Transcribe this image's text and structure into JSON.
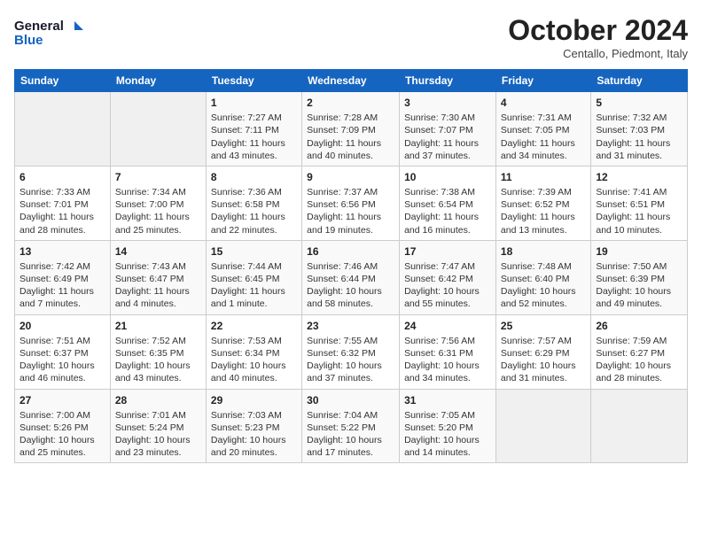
{
  "header": {
    "logo_general": "General",
    "logo_blue": "Blue",
    "month_title": "October 2024",
    "location": "Centallo, Piedmont, Italy"
  },
  "weekdays": [
    "Sunday",
    "Monday",
    "Tuesday",
    "Wednesday",
    "Thursday",
    "Friday",
    "Saturday"
  ],
  "weeks": [
    [
      {
        "day": "",
        "data": ""
      },
      {
        "day": "",
        "data": ""
      },
      {
        "day": "1",
        "data": "Sunrise: 7:27 AM\nSunset: 7:11 PM\nDaylight: 11 hours and 43 minutes."
      },
      {
        "day": "2",
        "data": "Sunrise: 7:28 AM\nSunset: 7:09 PM\nDaylight: 11 hours and 40 minutes."
      },
      {
        "day": "3",
        "data": "Sunrise: 7:30 AM\nSunset: 7:07 PM\nDaylight: 11 hours and 37 minutes."
      },
      {
        "day": "4",
        "data": "Sunrise: 7:31 AM\nSunset: 7:05 PM\nDaylight: 11 hours and 34 minutes."
      },
      {
        "day": "5",
        "data": "Sunrise: 7:32 AM\nSunset: 7:03 PM\nDaylight: 11 hours and 31 minutes."
      }
    ],
    [
      {
        "day": "6",
        "data": "Sunrise: 7:33 AM\nSunset: 7:01 PM\nDaylight: 11 hours and 28 minutes."
      },
      {
        "day": "7",
        "data": "Sunrise: 7:34 AM\nSunset: 7:00 PM\nDaylight: 11 hours and 25 minutes."
      },
      {
        "day": "8",
        "data": "Sunrise: 7:36 AM\nSunset: 6:58 PM\nDaylight: 11 hours and 22 minutes."
      },
      {
        "day": "9",
        "data": "Sunrise: 7:37 AM\nSunset: 6:56 PM\nDaylight: 11 hours and 19 minutes."
      },
      {
        "day": "10",
        "data": "Sunrise: 7:38 AM\nSunset: 6:54 PM\nDaylight: 11 hours and 16 minutes."
      },
      {
        "day": "11",
        "data": "Sunrise: 7:39 AM\nSunset: 6:52 PM\nDaylight: 11 hours and 13 minutes."
      },
      {
        "day": "12",
        "data": "Sunrise: 7:41 AM\nSunset: 6:51 PM\nDaylight: 11 hours and 10 minutes."
      }
    ],
    [
      {
        "day": "13",
        "data": "Sunrise: 7:42 AM\nSunset: 6:49 PM\nDaylight: 11 hours and 7 minutes."
      },
      {
        "day": "14",
        "data": "Sunrise: 7:43 AM\nSunset: 6:47 PM\nDaylight: 11 hours and 4 minutes."
      },
      {
        "day": "15",
        "data": "Sunrise: 7:44 AM\nSunset: 6:45 PM\nDaylight: 11 hours and 1 minute."
      },
      {
        "day": "16",
        "data": "Sunrise: 7:46 AM\nSunset: 6:44 PM\nDaylight: 10 hours and 58 minutes."
      },
      {
        "day": "17",
        "data": "Sunrise: 7:47 AM\nSunset: 6:42 PM\nDaylight: 10 hours and 55 minutes."
      },
      {
        "day": "18",
        "data": "Sunrise: 7:48 AM\nSunset: 6:40 PM\nDaylight: 10 hours and 52 minutes."
      },
      {
        "day": "19",
        "data": "Sunrise: 7:50 AM\nSunset: 6:39 PM\nDaylight: 10 hours and 49 minutes."
      }
    ],
    [
      {
        "day": "20",
        "data": "Sunrise: 7:51 AM\nSunset: 6:37 PM\nDaylight: 10 hours and 46 minutes."
      },
      {
        "day": "21",
        "data": "Sunrise: 7:52 AM\nSunset: 6:35 PM\nDaylight: 10 hours and 43 minutes."
      },
      {
        "day": "22",
        "data": "Sunrise: 7:53 AM\nSunset: 6:34 PM\nDaylight: 10 hours and 40 minutes."
      },
      {
        "day": "23",
        "data": "Sunrise: 7:55 AM\nSunset: 6:32 PM\nDaylight: 10 hours and 37 minutes."
      },
      {
        "day": "24",
        "data": "Sunrise: 7:56 AM\nSunset: 6:31 PM\nDaylight: 10 hours and 34 minutes."
      },
      {
        "day": "25",
        "data": "Sunrise: 7:57 AM\nSunset: 6:29 PM\nDaylight: 10 hours and 31 minutes."
      },
      {
        "day": "26",
        "data": "Sunrise: 7:59 AM\nSunset: 6:27 PM\nDaylight: 10 hours and 28 minutes."
      }
    ],
    [
      {
        "day": "27",
        "data": "Sunrise: 7:00 AM\nSunset: 5:26 PM\nDaylight: 10 hours and 25 minutes."
      },
      {
        "day": "28",
        "data": "Sunrise: 7:01 AM\nSunset: 5:24 PM\nDaylight: 10 hours and 23 minutes."
      },
      {
        "day": "29",
        "data": "Sunrise: 7:03 AM\nSunset: 5:23 PM\nDaylight: 10 hours and 20 minutes."
      },
      {
        "day": "30",
        "data": "Sunrise: 7:04 AM\nSunset: 5:22 PM\nDaylight: 10 hours and 17 minutes."
      },
      {
        "day": "31",
        "data": "Sunrise: 7:05 AM\nSunset: 5:20 PM\nDaylight: 10 hours and 14 minutes."
      },
      {
        "day": "",
        "data": ""
      },
      {
        "day": "",
        "data": ""
      }
    ]
  ]
}
